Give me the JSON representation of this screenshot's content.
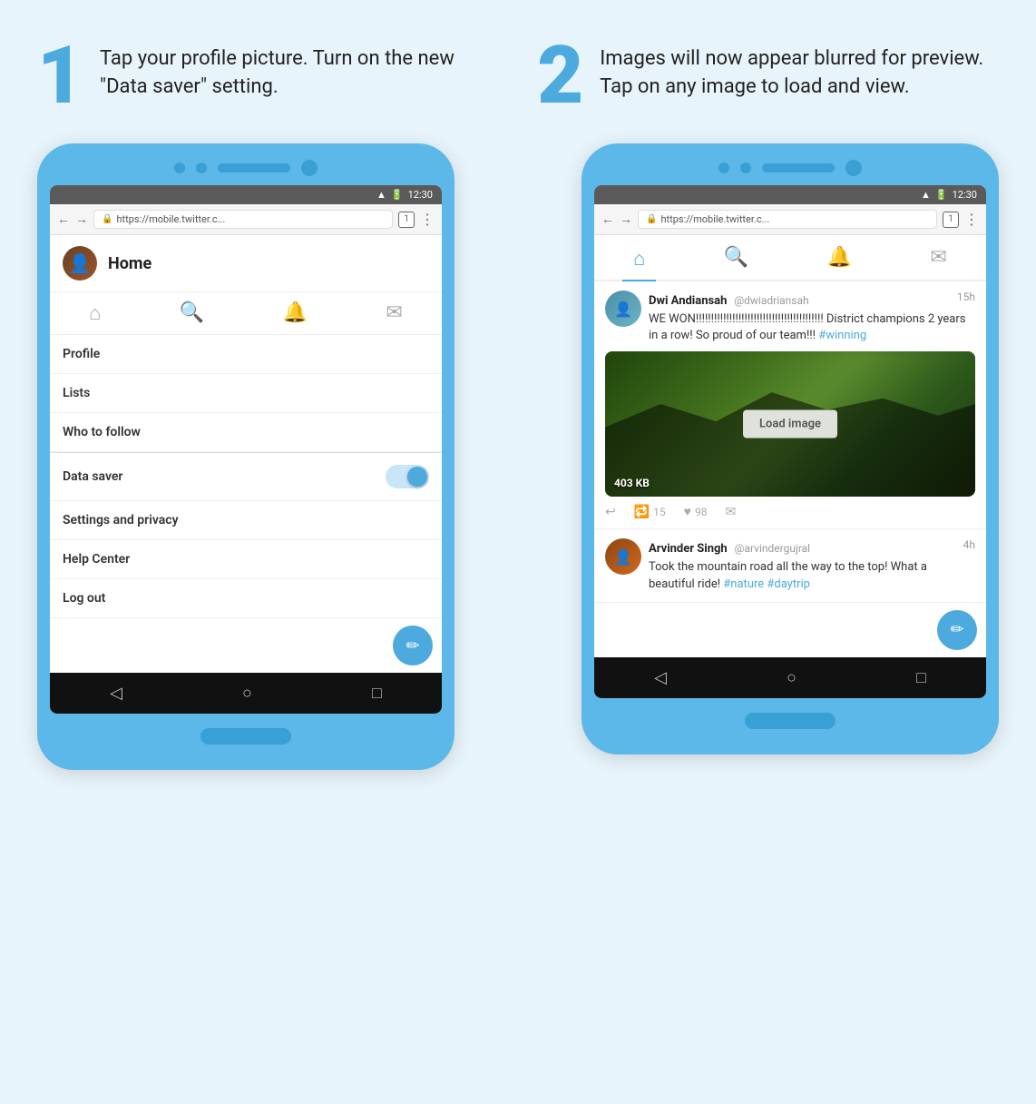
{
  "page": {
    "background": "#e8f4fb"
  },
  "step1": {
    "number": "1",
    "text": "Tap your profile picture. Turn on the new \"Data saver\" setting."
  },
  "step2": {
    "number": "2",
    "text": "Images will now appear blurred for preview. Tap on any image to load and view."
  },
  "phone1": {
    "status_bar": {
      "signal": "▲",
      "battery": "□",
      "time": "12:30"
    },
    "browser_url": "https://mobile.twitter.c...",
    "tab_count": "1",
    "home_title": "Home",
    "nav_icons": [
      "🏠",
      "🔍",
      "🔔",
      "✉"
    ],
    "menu_items": [
      {
        "label": "Profile"
      },
      {
        "label": "Lists"
      },
      {
        "label": "Who to follow"
      }
    ],
    "data_saver_label": "Data saver",
    "settings_label": "Settings and privacy",
    "help_label": "Help Center",
    "logout_label": "Log out",
    "fab_icon": "✏"
  },
  "phone2": {
    "status_bar": {
      "signal": "▲",
      "battery": "□",
      "time": "12:30"
    },
    "browser_url": "https://mobile.twitter.c...",
    "tab_count": "1",
    "nav_icons": [
      "🏠",
      "🔍",
      "🔔",
      "✉"
    ],
    "tweets": [
      {
        "name": "Dwi Andiansah",
        "handle": "@dwiadriansah",
        "time": "15h",
        "text": "WE WON!!!!!!!!!!!!!!!!!!!!!!!!!!!!!!!!!!!!!!!!!! District champions 2 years in a row! So proud of our team!!! ",
        "hashtag": "#winning",
        "has_image": true,
        "image_size": "403 KB",
        "load_image_label": "Load image",
        "retweet_count": "15",
        "like_count": "98"
      },
      {
        "name": "Arvinder Singh",
        "handle": "@arvindergujral",
        "time": "4h",
        "text": "Took the mountain road all the way to the top! What a beautiful ride! ",
        "hashtag": "#nature #daytrip",
        "has_image": false
      }
    ],
    "fab_icon": "✏"
  }
}
